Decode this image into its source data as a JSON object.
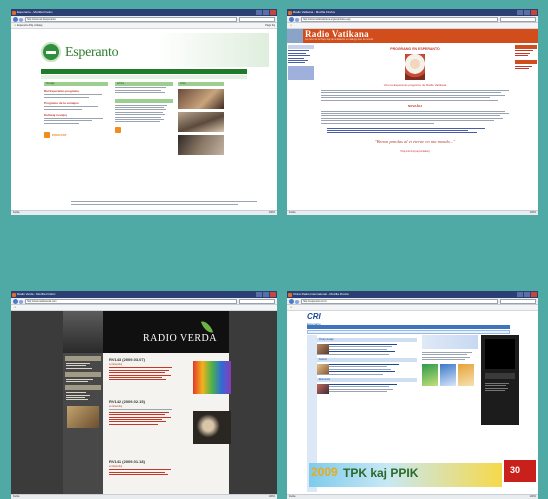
{
  "shots": [
    {
      "window_title": "Esperanto - Mozilla Firefox",
      "address": "http://www.rai.it/esperanto",
      "bookmarks": "Esperanto  Plej vizitataj",
      "tools": "Paĝo  Iloj",
      "status": "Farita",
      "zoom": "100%",
      "site_title": "Esperanto",
      "columns": [
        "Novaĵoj",
        "Arĥivo",
        "Fotoj"
      ],
      "links": [
        "Rai Esperanto-programo",
        "Programo de la semajno",
        "Kulturaj novaĵoj"
      ],
      "podcast_label": "PODCAST"
    },
    {
      "window_title": "Radio Vatikana - Mozilla Firefox",
      "address": "http://www.radiovaticana.org/esp/index.asp",
      "status": "Farita",
      "zoom": "100%",
      "site_title": "Radio Vatikana",
      "site_subtitle": "La voĉo de la Papo kaj de la Eklezio en dialogo kun la mondo",
      "program_title": "PROGRAMO EN ESPERANTO",
      "program_caption": "Vivu la Esperanto-programo de Radio Vatikana",
      "section_label": "NOVAĴOJ",
      "quote": "\"Benon parolas al vi eterne en nia mondo...\"",
      "footer_label": "Pliaj informoj kaj kontaktoj"
    },
    {
      "window_title": "Radio Verda - Mozilla Firefox",
      "address": "http://www.radioverda.com",
      "status": "Farita",
      "zoom": "100%",
      "site_title": "RADIO VERDA",
      "posts": [
        {
          "title": "RV143 (2009.03.07)",
          "meta": "en Elsendoj"
        },
        {
          "title": "RV142 (2009.02.15)",
          "meta": "en Elsendoj"
        },
        {
          "title": "RV141 (2009.01.18)",
          "meta": "en Elsendoj"
        }
      ]
    },
    {
      "window_title": "China Radio International - Mozilla Firefox",
      "address": "http://esperanto.cri.cn",
      "status": "Farita",
      "zoom": "100%",
      "logo_main": "CRI",
      "logo_sub": "Esperanto",
      "sections": [
        "Ĉinaj novaĵoj",
        "Kulturo",
        "Ekonomio"
      ],
      "banner_year": "2009",
      "banner_text": "TPK kaj PPIK",
      "red_badge": "30"
    }
  ]
}
